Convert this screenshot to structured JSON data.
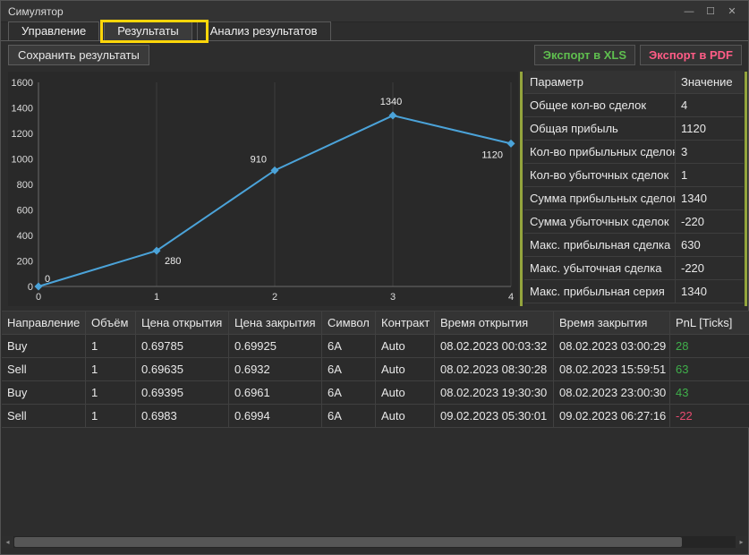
{
  "window": {
    "title": "Симулятор",
    "controls": {
      "minimize": "—",
      "maximize": "☐",
      "close": "✕"
    }
  },
  "tabs": [
    {
      "label": "Управление",
      "active": false
    },
    {
      "label": "Результаты",
      "active": true
    },
    {
      "label": "Анализ результатов",
      "active": false
    }
  ],
  "toolbar": {
    "save_label": "Сохранить результаты",
    "export_xls_label": "Экспорт в XLS",
    "export_pdf_label": "Экспорт в PDF"
  },
  "chart_data": {
    "type": "line",
    "x": [
      0,
      1,
      2,
      3,
      4
    ],
    "values": [
      0,
      280,
      910,
      1340,
      1120
    ],
    "point_labels": [
      "0",
      "280",
      "910",
      "1340",
      "1120"
    ],
    "xlim": [
      0,
      4
    ],
    "ylim": [
      0,
      1600
    ],
    "xticks": [
      0,
      1,
      2,
      3,
      4
    ],
    "yticks": [
      0,
      200,
      400,
      600,
      800,
      1000,
      1200,
      1400,
      1600
    ],
    "title": "",
    "xlabel": "",
    "ylabel": "",
    "grid": "vertical-only",
    "legend": "none",
    "line_color": "#4ba3d9",
    "marker": "diamond"
  },
  "params_table": {
    "headers": [
      "Параметр",
      "Значение"
    ],
    "rows": [
      [
        "Общее кол-во сделок",
        "4"
      ],
      [
        "Общая прибыль",
        "1120"
      ],
      [
        "Кол-во прибыльных сделок",
        "3"
      ],
      [
        "Кол-во убыточных сделок",
        "1"
      ],
      [
        "Сумма прибыльных сделок",
        "1340"
      ],
      [
        "Сумма убыточных сделок",
        "-220"
      ],
      [
        "Макс. прибыльная сделка",
        "630"
      ],
      [
        "Макс. убыточная сделка",
        "-220"
      ],
      [
        "Макс. прибыльная серия",
        "1340"
      ]
    ]
  },
  "trades_table": {
    "headers": [
      "Направление",
      "Объём",
      "Цена открытия",
      "Цена закрытия",
      "Символ",
      "Контракт",
      "Время открытия",
      "Время закрытия",
      "PnL [Ticks]"
    ],
    "rows": [
      [
        "Buy",
        "1",
        "0.69785",
        "0.69925",
        "6A",
        "Auto",
        "08.02.2023 00:03:32",
        "08.02.2023 03:00:29",
        "28"
      ],
      [
        "Sell",
        "1",
        "0.69635",
        "0.6932",
        "6A",
        "Auto",
        "08.02.2023 08:30:28",
        "08.02.2023 15:59:51",
        "63"
      ],
      [
        "Buy",
        "1",
        "0.69395",
        "0.6961",
        "6A",
        "Auto",
        "08.02.2023 19:30:30",
        "08.02.2023 23:00:30",
        "43"
      ],
      [
        "Sell",
        "1",
        "0.6983",
        "0.6994",
        "6A",
        "Auto",
        "09.02.2023 05:30:01",
        "09.02.2023 06:27:16",
        "-22"
      ]
    ]
  },
  "colors": {
    "pnl_positive": "#3fae4a",
    "pnl_negative": "#e84a6f",
    "export_xls": "#5fbf4f",
    "export_pdf": "#ff5c86",
    "chart_line": "#4ba3d9",
    "annotation_highlight": "#ffd60a",
    "splitter": "#94a53d"
  }
}
